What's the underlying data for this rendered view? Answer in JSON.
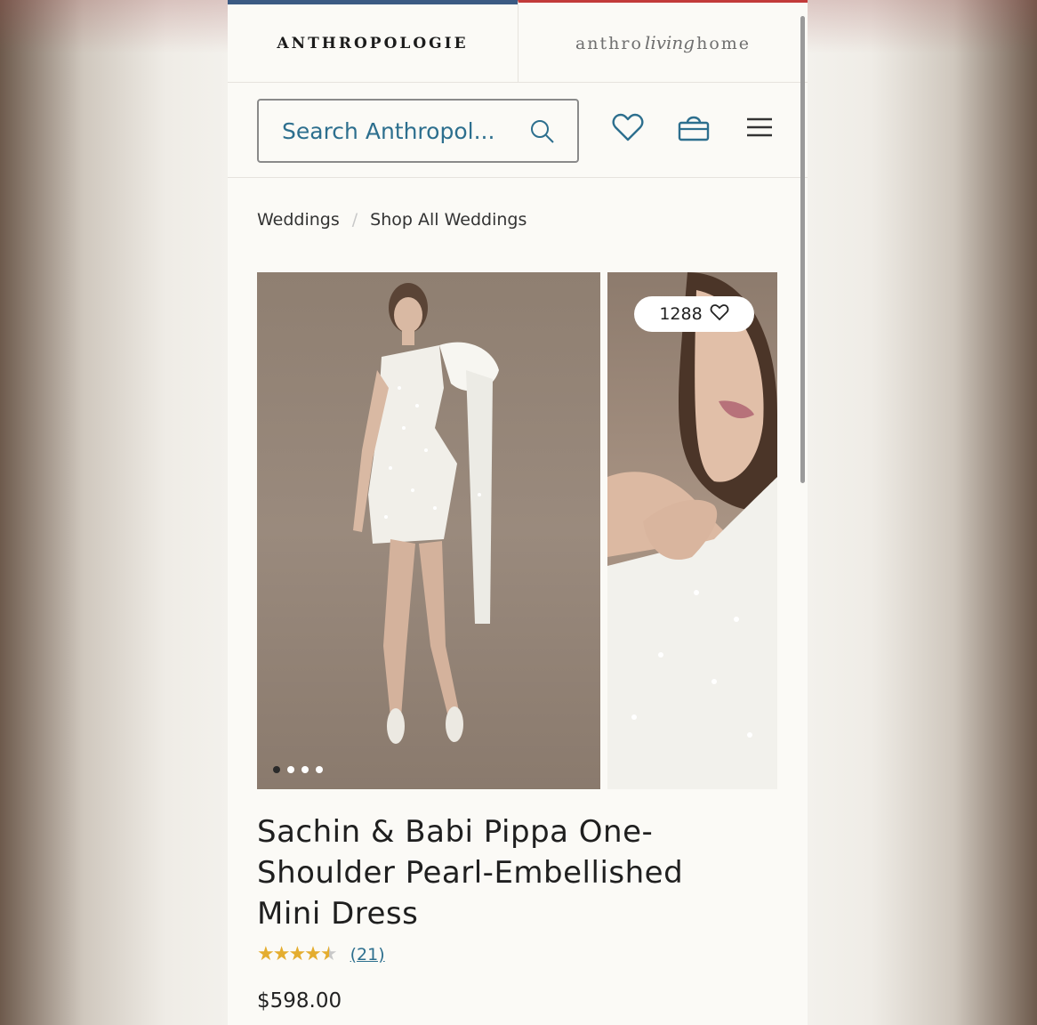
{
  "brand": {
    "anthropologie": "ANTHROPOLOGIE",
    "home_prefix": "anthro",
    "home_script": "living",
    "home_suffix": "home"
  },
  "search": {
    "placeholder": "Search Anthropol..."
  },
  "breadcrumb": [
    "Weddings",
    "Shop All Weddings"
  ],
  "gallery": {
    "favorites_count": "1288",
    "slide_count": 4,
    "active_slide": 1
  },
  "product": {
    "title": "Sachin & Babi Pippa One-Shoulder Pearl-Embellished Mini Dress",
    "rating": 4.5,
    "review_count": "(21)",
    "price": "$598.00"
  },
  "colors": {
    "accent_blue": "#2d6f8e",
    "star": "#e4ad2f",
    "brand_tab_active": "#3b5a83",
    "brand_tab_other": "#c23a3a"
  }
}
